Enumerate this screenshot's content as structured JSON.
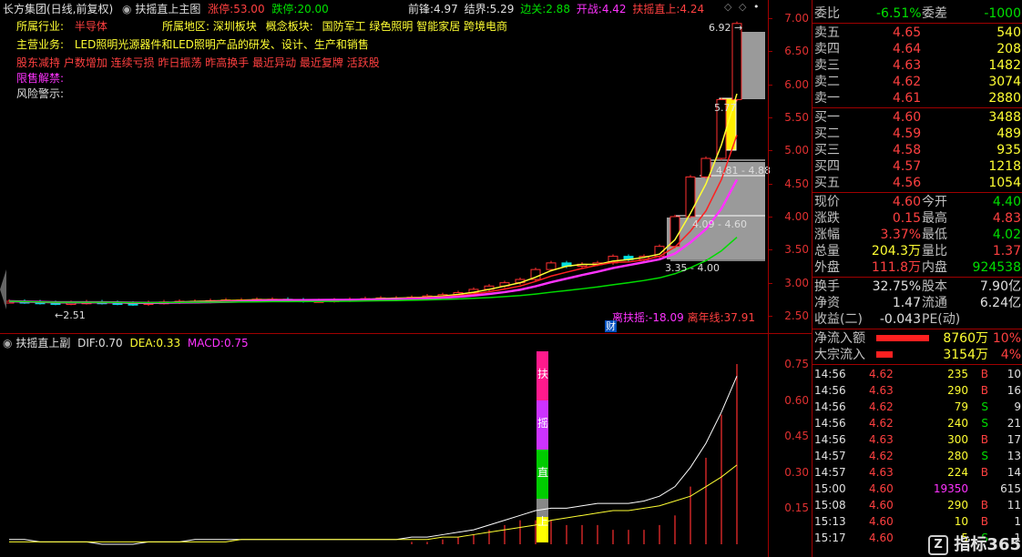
{
  "header": {
    "stock_name": "长方集团(日线,前复权)",
    "main_indicator": "扶摇直上主图",
    "limit_up_label": "涨停:",
    "limit_up_value": "53.00",
    "limit_down_label": "跌停:",
    "limit_down_value": "20.00",
    "front_label": "前锋:",
    "front_value": "4.97",
    "border_label": "结界:",
    "border_value": "5.29",
    "edge_label": "边关:",
    "edge_value": "2.88",
    "battle_label": "开战:",
    "battle_value": "4.42",
    "fuyao_label": "扶摇直上:",
    "fuyao_value": "4.24"
  },
  "info": {
    "industry_label": "所属行业:",
    "industry_value": "半导体",
    "region_label": "所属地区:",
    "region_value": "深圳板块",
    "concept_label": "概念板块:",
    "concept_value": "国防军工 绿色照明 智能家居 跨境电商",
    "business_label": "主营业务:",
    "business_value": "LED照明光源器件和LED照明产品的研发、设计、生产和销售",
    "tags": "股东减持 户数增加 连续亏损 昨日振荡 昨高换手 最近异动 最近复牌 活跃股",
    "unlock_label": "限售解禁:",
    "risk_label": "风险警示:"
  },
  "chart_labels": {
    "low_marker": "2.51",
    "high_marker": "6.92",
    "zone1": "5.77",
    "zone2": "4.81 - 4.88",
    "zone3": "4.09 - 4.60",
    "zone4": "3.35 - 4.00",
    "dist_label": "离扶摇:",
    "dist_value": "-18.09",
    "year_label": "离年线:",
    "year_value": "37.91",
    "cai": "财"
  },
  "main_axis": [
    "7.00",
    "6.50",
    "6.00",
    "5.50",
    "5.00",
    "4.50",
    "4.00",
    "3.50",
    "3.00",
    "2.50"
  ],
  "sub_header": {
    "name": "扶摇直上副",
    "dif_label": "DIF:",
    "dif_value": "0.70",
    "dea_label": "DEA:",
    "dea_value": "0.33",
    "macd_label": "MACD:",
    "macd_value": "0.75"
  },
  "sub_axis": [
    "0.75",
    "0.60",
    "0.45",
    "0.30",
    "0.15"
  ],
  "vertical_text": [
    "扶",
    "摇",
    "直",
    "上"
  ],
  "chart_data": {
    "type": "candlestick",
    "ylim": [
      2.3,
      7.2
    ],
    "closes": [
      2.72,
      2.71,
      2.7,
      2.69,
      2.7,
      2.71,
      2.7,
      2.69,
      2.68,
      2.7,
      2.71,
      2.72,
      2.72,
      2.73,
      2.74,
      2.74,
      2.75,
      2.75,
      2.74,
      2.73,
      2.73,
      2.74,
      2.75,
      2.76,
      2.77,
      2.77,
      2.78,
      2.8,
      2.82,
      2.85,
      2.9,
      2.95,
      3.0,
      3.05,
      3.2,
      3.3,
      3.25,
      3.28,
      3.3,
      3.4,
      3.35,
      3.4,
      3.55,
      4.0,
      4.6,
      4.88,
      5.77,
      6.92
    ],
    "macd_dif": [
      0.02,
      0.02,
      0.01,
      0.01,
      0.01,
      0.01,
      0.0,
      0.0,
      0.0,
      0.01,
      0.01,
      0.01,
      0.02,
      0.02,
      0.02,
      0.02,
      0.02,
      0.02,
      0.02,
      0.02,
      0.02,
      0.02,
      0.02,
      0.02,
      0.02,
      0.02,
      0.03,
      0.03,
      0.04,
      0.05,
      0.06,
      0.08,
      0.1,
      0.12,
      0.14,
      0.15,
      0.15,
      0.16,
      0.17,
      0.17,
      0.17,
      0.18,
      0.2,
      0.24,
      0.32,
      0.42,
      0.55,
      0.7
    ],
    "macd_dea": [
      0.01,
      0.01,
      0.01,
      0.01,
      0.01,
      0.01,
      0.01,
      0.01,
      0.01,
      0.01,
      0.01,
      0.01,
      0.01,
      0.01,
      0.01,
      0.02,
      0.02,
      0.02,
      0.02,
      0.02,
      0.02,
      0.02,
      0.02,
      0.02,
      0.02,
      0.02,
      0.02,
      0.02,
      0.03,
      0.03,
      0.04,
      0.05,
      0.06,
      0.07,
      0.08,
      0.1,
      0.11,
      0.12,
      0.13,
      0.14,
      0.14,
      0.15,
      0.16,
      0.18,
      0.2,
      0.24,
      0.28,
      0.33
    ],
    "macd_bar": [
      0.0,
      0.0,
      0.0,
      0.0,
      0.0,
      0.0,
      0.0,
      0.0,
      0.0,
      0.0,
      0.0,
      0.0,
      0.0,
      0.0,
      0.0,
      0.0,
      0.0,
      0.0,
      0.0,
      0.0,
      0.0,
      0.0,
      0.0,
      0.0,
      0.0,
      0.0,
      0.01,
      0.01,
      0.02,
      0.03,
      0.04,
      0.06,
      0.08,
      0.1,
      0.1,
      0.1,
      0.08,
      0.08,
      0.08,
      0.06,
      0.06,
      0.06,
      0.08,
      0.12,
      0.24,
      0.36,
      0.54,
      0.75
    ],
    "macd_ylim": [
      0,
      0.8
    ]
  },
  "panel": {
    "weibi_label": "委比",
    "weibi_value": "-6.51%",
    "weicha_label": "委差",
    "weicha_value": "-1000",
    "asks": [
      {
        "label": "卖五",
        "price": "4.65",
        "vol": "540"
      },
      {
        "label": "卖四",
        "price": "4.64",
        "vol": "208"
      },
      {
        "label": "卖三",
        "price": "4.63",
        "vol": "1482"
      },
      {
        "label": "卖二",
        "price": "4.62",
        "vol": "3074"
      },
      {
        "label": "卖一",
        "price": "4.61",
        "vol": "2880"
      }
    ],
    "bids": [
      {
        "label": "买一",
        "price": "4.60",
        "vol": "3488"
      },
      {
        "label": "买二",
        "price": "4.59",
        "vol": "489"
      },
      {
        "label": "买三",
        "price": "4.58",
        "vol": "935"
      },
      {
        "label": "买四",
        "price": "4.57",
        "vol": "1218"
      },
      {
        "label": "买五",
        "price": "4.56",
        "vol": "1054"
      }
    ],
    "stats": [
      {
        "l1": "现价",
        "v1": "4.60",
        "l2": "今开",
        "v2": "4.40",
        "c1": "c-red",
        "c2": "c-grn"
      },
      {
        "l1": "涨跌",
        "v1": "0.15",
        "l2": "最高",
        "v2": "4.83",
        "c1": "c-red",
        "c2": "c-red"
      },
      {
        "l1": "涨幅",
        "v1": "3.37%",
        "l2": "最低",
        "v2": "4.02",
        "c1": "c-red",
        "c2": "c-grn"
      },
      {
        "l1": "总量",
        "v1": "204.3万",
        "l2": "量比",
        "v2": "1.37",
        "c1": "c-yel",
        "c2": "c-red"
      },
      {
        "l1": "外盘",
        "v1": "111.8万",
        "l2": "内盘",
        "v2": "924538",
        "c1": "c-red",
        "c2": "c-grn"
      }
    ],
    "stats2": [
      {
        "l1": "换手",
        "v1": "32.75%",
        "l2": "股本",
        "v2": "7.90亿"
      },
      {
        "l1": "净资",
        "v1": "1.47",
        "l2": "流通",
        "v2": "6.24亿"
      },
      {
        "l1": "收益(二)",
        "v1": "-0.043",
        "l2": "PE(动)",
        "v2": ""
      }
    ],
    "flow": [
      {
        "label": "净流入额",
        "value": "8760万",
        "pct": "10%",
        "bar": 0.72
      },
      {
        "label": "大宗流入",
        "value": "3154万",
        "pct": "4%",
        "bar": 0.22
      }
    ],
    "ticks": [
      {
        "t": "14:56",
        "p": "4.62",
        "v": "235",
        "d": "B",
        "n": "10"
      },
      {
        "t": "14:56",
        "p": "4.63",
        "v": "290",
        "d": "B",
        "n": "16"
      },
      {
        "t": "14:56",
        "p": "4.62",
        "v": "79",
        "d": "S",
        "n": "9"
      },
      {
        "t": "14:56",
        "p": "4.62",
        "v": "240",
        "d": "S",
        "n": "21"
      },
      {
        "t": "14:56",
        "p": "4.63",
        "v": "300",
        "d": "B",
        "n": "17"
      },
      {
        "t": "14:57",
        "p": "4.62",
        "v": "280",
        "d": "S",
        "n": "13"
      },
      {
        "t": "14:57",
        "p": "4.63",
        "v": "224",
        "d": "B",
        "n": "14"
      },
      {
        "t": "15:00",
        "p": "4.60",
        "v": "19350",
        "d": "",
        "n": "615"
      },
      {
        "t": "15:08",
        "p": "4.60",
        "v": "290",
        "d": "B",
        "n": "11"
      },
      {
        "t": "15:13",
        "p": "4.60",
        "v": "10",
        "d": "B",
        "n": "1"
      },
      {
        "t": "15:17",
        "p": "4.60",
        "v": "5",
        "d": "S",
        "n": "1"
      }
    ],
    "watermark": "指标365"
  }
}
